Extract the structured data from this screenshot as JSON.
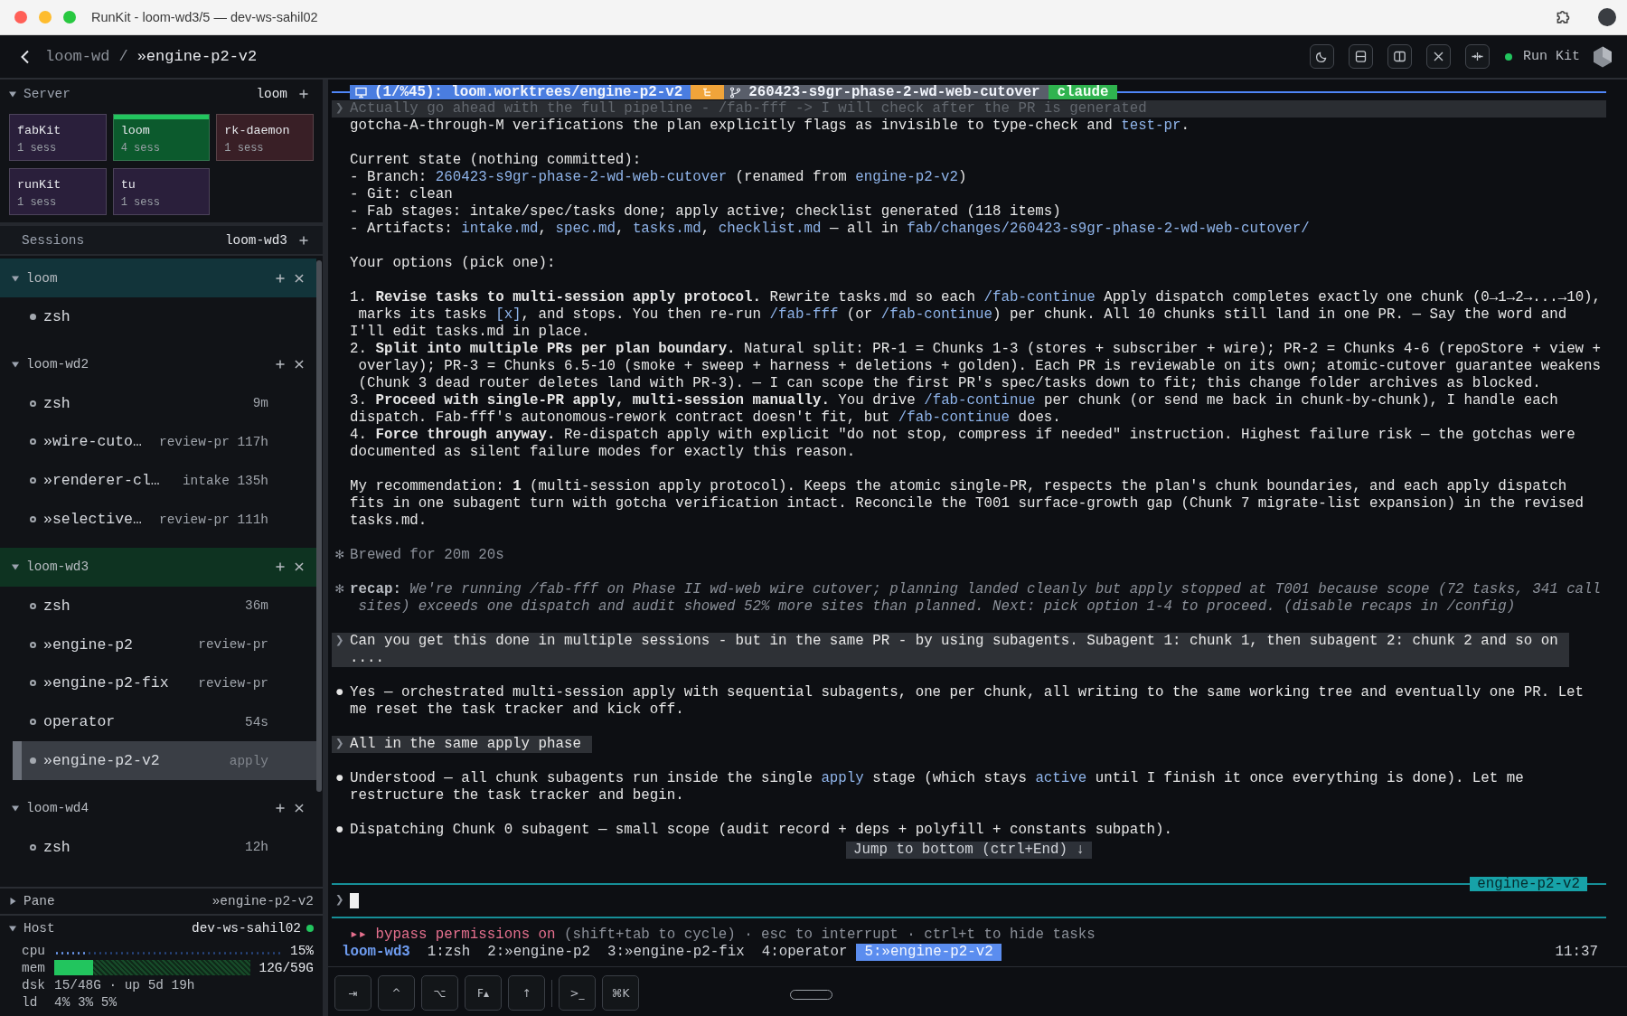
{
  "window": {
    "title": "RunKit - loom-wd3/5 — dev-ws-sahil02"
  },
  "header": {
    "parent": "loom-wd",
    "separator": "/",
    "current": "»engine-p2-v2",
    "brand": "Run Kit",
    "connected": true
  },
  "server": {
    "title": "Server",
    "expanded": true,
    "current": "loom",
    "tiles": [
      {
        "name": "fabKit",
        "sessions": "1 sess",
        "color": "#2a1f3b",
        "selected": false
      },
      {
        "name": "loom",
        "sessions": "4 sess",
        "color": "#0c5a2d",
        "selected": true
      },
      {
        "name": "rk-daemon",
        "sessions": "1 sess",
        "color": "#391f26",
        "selected": false
      },
      {
        "name": "runKit",
        "sessions": "1 sess",
        "color": "#2a1f3b",
        "selected": false
      },
      {
        "name": "tu",
        "sessions": "1 sess",
        "color": "#2a1f3b",
        "selected": false
      }
    ]
  },
  "sessions": {
    "title": "Sessions",
    "current": "loom-wd3",
    "groups": [
      {
        "name": "loom",
        "expanded": true,
        "hovered": true,
        "current": false,
        "windows": [
          {
            "name": "zsh",
            "active": true,
            "selected": false
          }
        ]
      },
      {
        "name": "loom-wd2",
        "expanded": true,
        "hovered": false,
        "current": false,
        "windows": [
          {
            "name": "zsh",
            "age": "9m",
            "active": false,
            "selected": false
          },
          {
            "name": "»wire-cuto…",
            "stage": "review-pr",
            "age": "117h",
            "active": false,
            "selected": false
          },
          {
            "name": "»renderer-cl…",
            "stage": "intake",
            "age": "135h",
            "active": false,
            "selected": false
          },
          {
            "name": "»selective…",
            "stage": "review-pr",
            "age": "111h",
            "active": false,
            "selected": false
          }
        ]
      },
      {
        "name": "loom-wd3",
        "expanded": true,
        "hovered": false,
        "current": true,
        "windows": [
          {
            "name": "zsh",
            "age": "36m",
            "active": false,
            "selected": false
          },
          {
            "name": "»engine-p2",
            "stage": "review-pr",
            "active": false,
            "selected": false
          },
          {
            "name": "»engine-p2-fix",
            "stage": "review-pr",
            "active": false,
            "selected": false
          },
          {
            "name": "operator",
            "age": "54s",
            "active": false,
            "selected": false
          },
          {
            "name": "»engine-p2-v2",
            "stage": "apply",
            "active": true,
            "selected": true
          }
        ]
      },
      {
        "name": "loom-wd4",
        "expanded": true,
        "hovered": false,
        "current": false,
        "windows": [
          {
            "name": "zsh",
            "age": "12h",
            "active": false,
            "selected": false
          }
        ]
      }
    ]
  },
  "pane": {
    "title": "Pane",
    "expanded": false,
    "value": "»engine-p2-v2"
  },
  "host": {
    "title": "Host",
    "expanded": true,
    "name": "dev-ws-sahil02",
    "online": true,
    "meters": [
      {
        "label": "cpu",
        "kind": "dots",
        "level": 0.15,
        "reading": "15%"
      },
      {
        "label": "mem",
        "kind": "bar",
        "level": 0.2,
        "reading": "12G/59G"
      }
    ],
    "stats": [
      {
        "label": "dsk",
        "value": "15/48G · up 5d 19h"
      },
      {
        "label": "ld",
        "value": "4% 3% 5%"
      }
    ]
  },
  "terminal": {
    "pane_bar": {
      "pane": "(1/%45): loom.worktrees/engine-p2-v2",
      "branch": "260423-s9gr-phase-2-wd-web-cutover",
      "agent": "claude"
    },
    "blocks": [
      {
        "kind": "echo",
        "marker": "❯",
        "paragraphs": [
          [
            [
              "Actually go ahead with the full pipeline - /fab-fff -> I will check after the PR is generated"
            ]
          ]
        ]
      },
      {
        "kind": "text",
        "paragraphs": [
          [
            [
              "gotcha-A-through-M verifications the plan explicitly flags as invisible to type-check and ",
              {
                "text": "test-pr",
                "kind": "code"
              },
              "."
            ]
          ]
        ]
      },
      {
        "kind": "text",
        "paragraphs": [
          [
            [
              "Current state (nothing committed):"
            ]
          ],
          [
            [
              "- Branch: ",
              {
                "text": "260423-s9gr-phase-2-wd-web-cutover",
                "kind": "code"
              },
              " (renamed from ",
              {
                "text": "engine-p2-v2",
                "kind": "code"
              },
              ")"
            ]
          ],
          [
            [
              "- Git: clean"
            ]
          ],
          [
            [
              "- Fab stages: intake/spec/tasks done; apply active; checklist generated (118 items)"
            ]
          ],
          [
            [
              "- Artifacts: ",
              {
                "text": "intake.md",
                "kind": "code"
              },
              ", ",
              {
                "text": "spec.md",
                "kind": "code"
              },
              ", ",
              {
                "text": "tasks.md",
                "kind": "code"
              },
              ", ",
              {
                "text": "checklist.md",
                "kind": "code"
              },
              " — all in ",
              {
                "text": "fab/changes/260423-s9gr-phase-2-wd-web-cutover/",
                "kind": "code"
              }
            ]
          ]
        ]
      },
      {
        "kind": "text",
        "paragraphs": [
          [
            [
              "Your options (pick one):"
            ]
          ]
        ]
      },
      {
        "kind": "text",
        "paragraphs": [
          [
            [
              "1. ",
              {
                "text": "Revise tasks to multi-session apply protocol.",
                "kind": "bold"
              },
              " Rewrite tasks.md so each ",
              {
                "text": "/fab-continue",
                "kind": "code"
              },
              " Apply dispatch completes exactly one chunk (0→1→2→...→10),"
            ],
            [
              " marks its tasks ",
              {
                "text": "[x]",
                "kind": "code"
              },
              ", and stops. You then re-run ",
              {
                "text": "/fab-fff",
                "kind": "code"
              },
              " (or ",
              {
                "text": "/fab-continue",
                "kind": "code"
              },
              ") per chunk. All 10 chunks still land in one PR. — Say the word and"
            ],
            [
              "I'll edit tasks.md in place."
            ]
          ],
          [
            [
              "2. ",
              {
                "text": "Split into multiple PRs per plan boundary.",
                "kind": "bold"
              },
              " Natural split: PR-1 = Chunks 1-3 (stores + subscriber + wire); PR-2 = Chunks 4-6 (repoStore + view +"
            ],
            [
              " overlay); PR-3 = Chunks 6.5-10 (smoke + sweep + harness + deletions + golden). Each PR is reviewable on its own; atomic-cutover guarantee weakens"
            ],
            [
              " (Chunk 3 dead router deletes land with PR-3). — I can scope the first PR's spec/tasks down to fit; this change folder archives as blocked."
            ]
          ],
          [
            [
              "3. ",
              {
                "text": "Proceed with single-PR apply, multi-session manually.",
                "kind": "bold"
              },
              " You drive ",
              {
                "text": "/fab-continue",
                "kind": "code"
              },
              " per chunk (or send me back in chunk-by-chunk), I handle each"
            ],
            [
              "dispatch. Fab-fff's autonomous-rework contract doesn't fit, but ",
              {
                "text": "/fab-continue",
                "kind": "code"
              },
              " does."
            ]
          ],
          [
            [
              "4. ",
              {
                "text": "Force through anyway.",
                "kind": "bold"
              },
              " Re-dispatch apply with explicit \"do not stop, compress if needed\" instruction. Highest failure risk — the gotchas were"
            ],
            [
              "documented as silent failure modes for exactly this reason."
            ]
          ]
        ]
      },
      {
        "kind": "text",
        "paragraphs": [
          [
            [
              "My recommendation: ",
              {
                "text": "1",
                "kind": "bold"
              },
              " (multi-session apply protocol). Keeps the atomic single-PR, respects the plan's chunk boundaries, and each apply dispatch"
            ],
            [
              "fits in one subagent turn with gotcha verification intact. Reconcile the T001 surface-growth gap (Chunk 7 migrate-list expansion) in the revised"
            ],
            [
              "tasks.md."
            ]
          ]
        ]
      },
      {
        "kind": "meta",
        "marker": "✻",
        "paragraphs": [
          [
            [
              "Brewed for 20m 20s"
            ]
          ]
        ]
      },
      {
        "kind": "recap",
        "marker": "✻",
        "paragraphs": [
          [
            [
              {
                "text": "recap:",
                "kind": "bold"
              },
              {
                "text": " We're running /fab-fff on Phase II wd-web wire cutover; planning landed cleanly but apply stopped at T001 because scope (72 tasks, 341 call",
                "kind": "italic"
              }
            ],
            [
              {
                "text": " sites) exceeds one dispatch and audit showed 52% more sites than planned. Next: pick option 1-4 to proceed. (disable recaps in /config)",
                "kind": "italic"
              }
            ]
          ]
        ]
      },
      {
        "kind": "prompt",
        "marker": "❯",
        "paragraphs": [
          [
            [
              "Can you get this done in multiple sessions - but in the same PR - by using subagents. Subagent 1: chunk 1, then subagent 2: chunk 2 and so on"
            ],
            [
              "...."
            ]
          ]
        ]
      },
      {
        "kind": "reply",
        "marker": "●",
        "paragraphs": [
          [
            [
              "Yes — orchestrated multi-session apply with sequential subagents, one per chunk, all writing to the same working tree and eventually one PR. Let"
            ],
            [
              "me reset the task tracker and kick off."
            ]
          ]
        ]
      },
      {
        "kind": "prompt",
        "marker": "❯",
        "paragraphs": [
          [
            [
              "All in the same apply phase"
            ]
          ]
        ]
      },
      {
        "kind": "reply",
        "marker": "●",
        "paragraphs": [
          [
            [
              "Understood — all chunk subagents run inside the single ",
              {
                "text": "apply",
                "kind": "code"
              },
              " stage (which stays ",
              {
                "text": "active",
                "kind": "code"
              },
              " until I finish it once everything is done). Let me"
            ],
            [
              "restructure the task tracker and begin."
            ]
          ]
        ]
      },
      {
        "kind": "reply",
        "marker": "●",
        "paragraphs": [
          [
            [
              "Dispatching Chunk 0 subagent — small scope (audit record + deps + polyfill + constants subpath)."
            ]
          ]
        ]
      }
    ],
    "jump_button": "Jump to bottom (ctrl+End) ↓",
    "prompt": {
      "marker": "❯",
      "label": "engine-p2-v2"
    },
    "mode_line": [
      {
        "text": "▸▸ bypass permissions on",
        "kind": "warn"
      },
      " (shift+tab to cycle) · esc to interrupt · ctrl+t to hide tasks"
    ],
    "status_line": {
      "session": "loom-wd3",
      "windows": [
        {
          "label": "1:zsh",
          "selected": false
        },
        {
          "label": "2:»engine-p2",
          "selected": false
        },
        {
          "label": "3:»engine-p2-fix",
          "selected": false
        },
        {
          "label": "4:operator",
          "selected": false
        },
        {
          "label": "5:»engine-p2-v2",
          "selected": true
        }
      ],
      "clock": "11:37"
    },
    "key_groups": [
      [
        "⇥",
        "^",
        "⌥",
        "F▴",
        "↑"
      ],
      [
        ">_",
        "⌘K"
      ]
    ]
  }
}
